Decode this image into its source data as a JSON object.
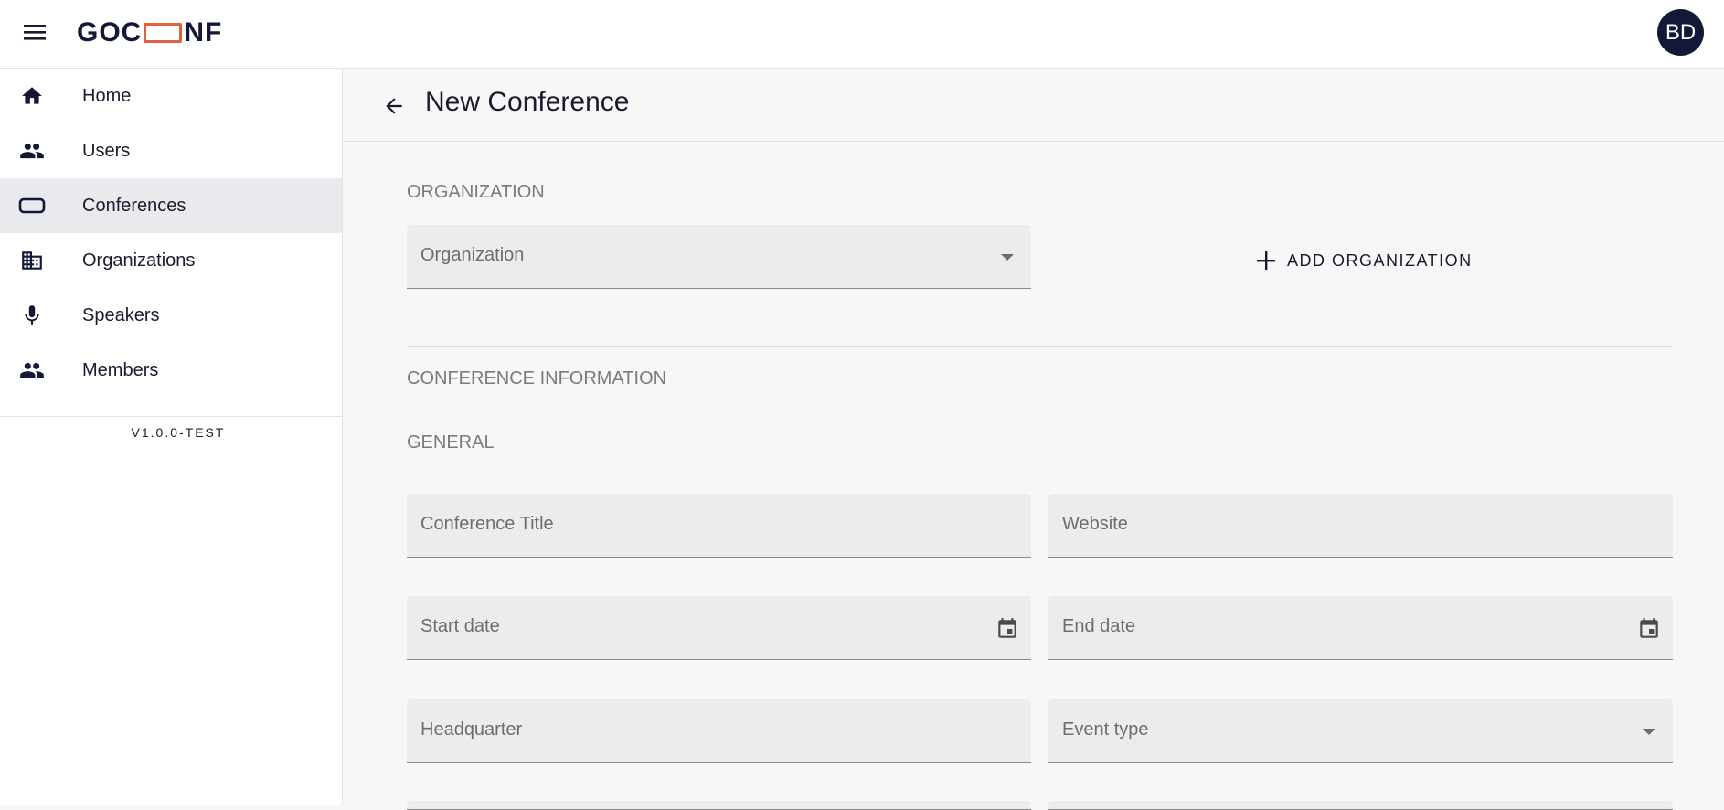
{
  "header": {
    "logo_text_start": "GOC",
    "logo_text_end": "NF",
    "avatar_initials": "BD"
  },
  "sidebar": {
    "items": [
      {
        "label": "Home",
        "icon": "home-icon"
      },
      {
        "label": "Users",
        "icon": "users-icon"
      },
      {
        "label": "Conferences",
        "icon": "conference-icon",
        "active": true
      },
      {
        "label": "Organizations",
        "icon": "organization-icon"
      },
      {
        "label": "Speakers",
        "icon": "microphone-icon"
      },
      {
        "label": "Members",
        "icon": "members-icon"
      }
    ],
    "version": "V1.0.0-TEST"
  },
  "page": {
    "title": "New Conference"
  },
  "form": {
    "organization_section": "ORGANIZATION",
    "organization_placeholder": "Organization",
    "add_organization_label": "ADD ORGANIZATION",
    "conference_info_section": "CONFERENCE INFORMATION",
    "general_section": "GENERAL",
    "conference_title_placeholder": "Conference Title",
    "website_placeholder": "Website",
    "start_date_placeholder": "Start date",
    "end_date_placeholder": "End date",
    "headquarter_placeholder": "Headquarter",
    "event_type_placeholder": "Event type"
  },
  "colors": {
    "brand_dark": "#131836",
    "brand_accent": "#e2613b",
    "active_nav_bg": "#e9eaee"
  }
}
